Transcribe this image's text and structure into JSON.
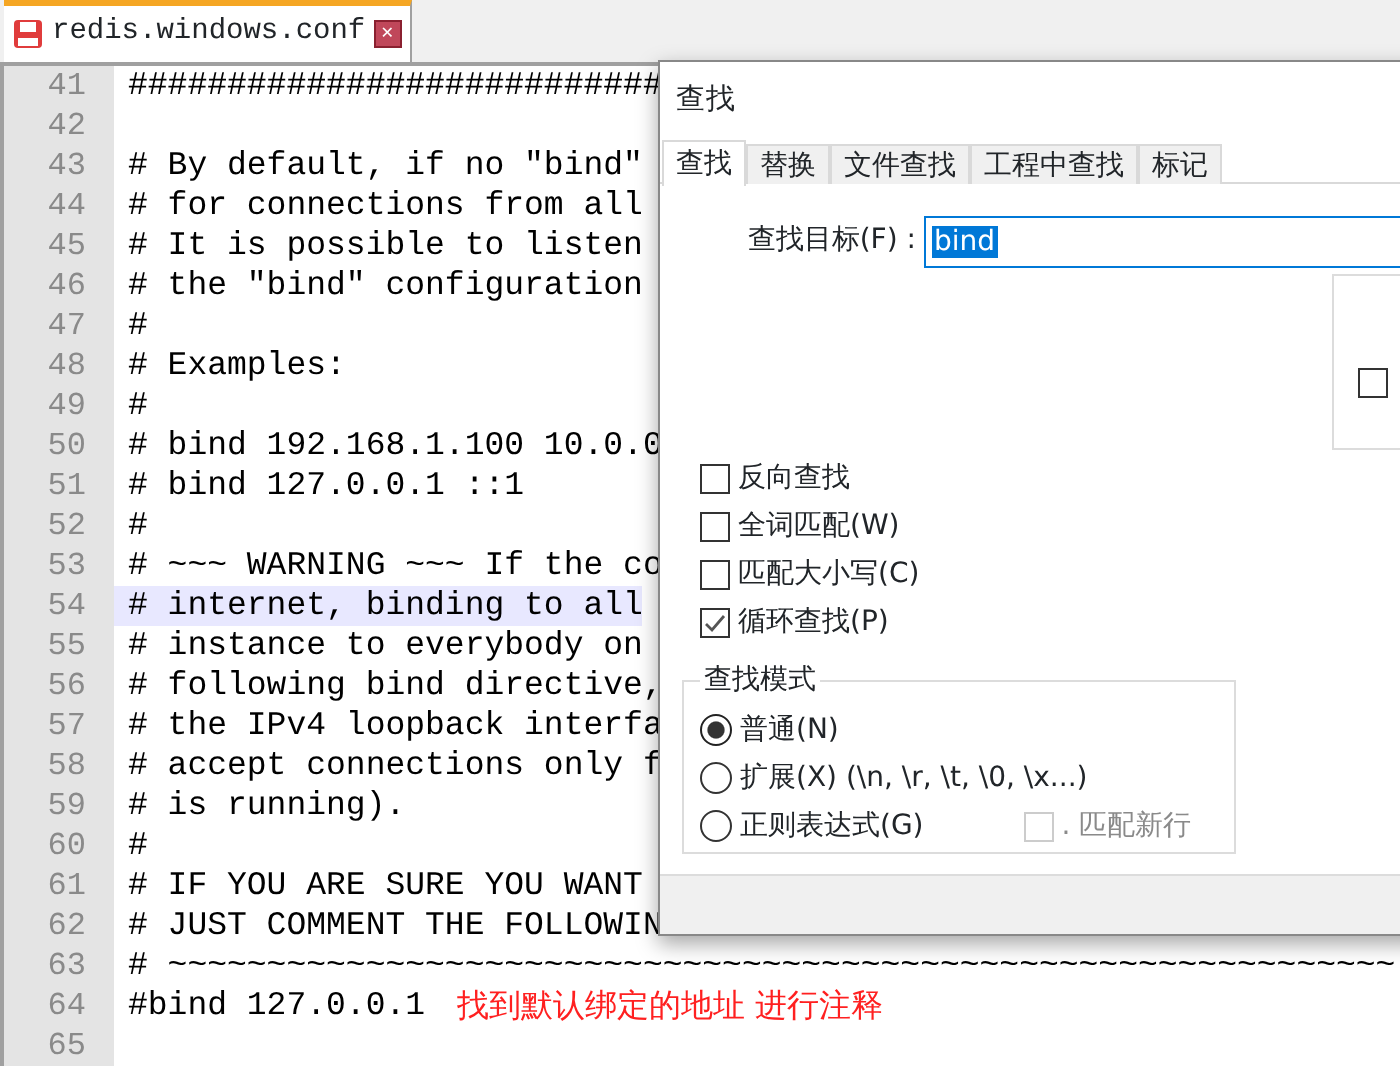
{
  "file_tabs": [
    {
      "label": "redis.windows.conf",
      "selected": true,
      "close": "✕"
    }
  ],
  "editor": {
    "lines": [
      {
        "number": "41",
        "text": "###########################",
        "current": false
      },
      {
        "number": "42",
        "current": false
      },
      {
        "number": "43",
        "text": "# By default, if no \"bind\"",
        "current": false
      },
      {
        "number": "44",
        "text": "# for connections from all",
        "current": false
      },
      {
        "number": "45",
        "text": "# It is possible to listen",
        "current": false
      },
      {
        "number": "46",
        "text": "# the \"bind\" configuration",
        "current": false
      },
      {
        "number": "47",
        "text": "#",
        "current": false
      },
      {
        "number": "48",
        "text": "# Examples:",
        "current": false
      },
      {
        "number": "49",
        "text": "#",
        "current": false
      },
      {
        "number": "50",
        "text": "# bind 192.168.1.100 10.0.0",
        "current": false
      },
      {
        "number": "51",
        "text": "# bind 127.0.0.1 ::1",
        "current": false
      },
      {
        "number": "52",
        "text": "#",
        "current": false
      },
      {
        "number": "53",
        "text": "# ~~~ WARNING ~~~ If the co",
        "current": false
      },
      {
        "number": "54",
        "text": "# internet, binding to all",
        "current": true
      },
      {
        "number": "55",
        "text": "# instance to everybody on",
        "current": false
      },
      {
        "number": "56",
        "text": "# following bind directive,",
        "current": false
      },
      {
        "number": "57",
        "text": "# the IPv4 loopback interfa",
        "current": false
      },
      {
        "number": "58",
        "text": "# accept connections only f",
        "current": false
      },
      {
        "number": "59",
        "text": "# is running).",
        "current": false
      },
      {
        "number": "60",
        "text": "#",
        "current": false
      },
      {
        "number": "61",
        "text": "# IF YOU ARE SURE YOU WANT",
        "current": false
      },
      {
        "number": "62",
        "text": "# JUST COMMENT THE FOLLOWIN",
        "current": false
      },
      {
        "number": "63",
        "text": "# ~~~~~~~~~~~~~~~~~~~~~~~~~~~~~~~~~~~~~~~~~~~~~~~~~~~~~~~~~~~~~~",
        "current": false
      },
      {
        "number": "64",
        "text": "#bind 127.0.0.1",
        "current": false,
        "note": "找到默认绑定的地址 进行注释"
      },
      {
        "number": "65",
        "current": false
      }
    ]
  },
  "find_dialog": {
    "title": "查找",
    "tabs": [
      {
        "label": "查找",
        "selected": true
      },
      {
        "label": "替换",
        "selected": false
      },
      {
        "label": "文件查找",
        "selected": false
      },
      {
        "label": "工程中查找",
        "selected": false
      },
      {
        "label": "标记",
        "selected": false
      }
    ],
    "find_label": "查找目标(F) :",
    "find_value": "bind",
    "group_box_2": {
      "checked": false
    },
    "options": [
      {
        "label": "反向查找",
        "checked": false
      },
      {
        "label": "全词匹配(W)",
        "checked": false
      },
      {
        "label": "匹配大小写(C)",
        "checked": false
      },
      {
        "label": "循环查找(P)",
        "checked": true
      }
    ],
    "search_mode": {
      "title": "查找模式",
      "modes": [
        {
          "label": "普通(N)",
          "selected": true
        },
        {
          "label": "扩展(X) (\\n, \\r, \\t, \\0, \\x...)",
          "selected": false
        },
        {
          "label": "正则表达式(G)",
          "selected": false
        }
      ],
      "dot_newline": {
        "label": ". 匹配新行",
        "checked": false,
        "disabled": true
      }
    }
  }
}
